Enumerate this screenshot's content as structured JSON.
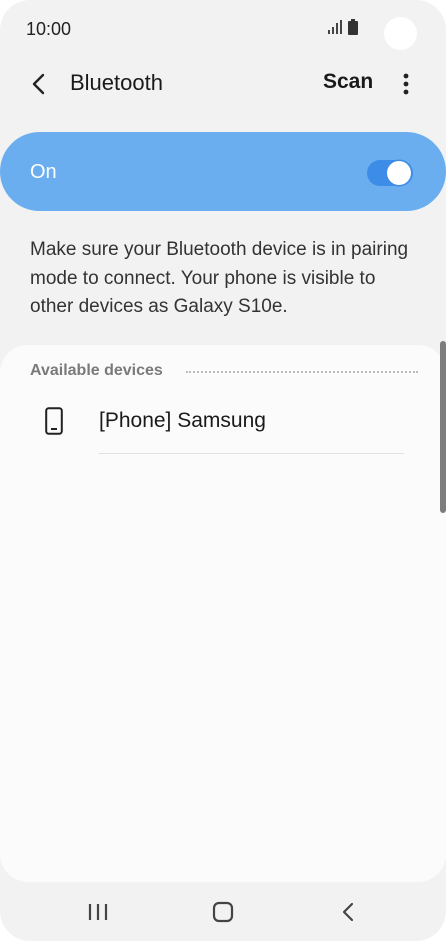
{
  "status_bar": {
    "time": "10:00",
    "icons": [
      "signal-icon",
      "battery-icon"
    ]
  },
  "app_bar": {
    "title": "Bluetooth",
    "scan_label": "Scan",
    "back_icon": "back-arrow-icon",
    "more_icon": "more-options-icon"
  },
  "master_switch": {
    "label": "On",
    "enabled": true
  },
  "description": "Make sure your Bluetooth device is in pairing mode to connect. Your phone is visible to other devices as Galaxy S10e.",
  "available_devices": {
    "header": "Available devices",
    "items": [
      {
        "name": "[Phone] Samsung",
        "icon": "phone-icon"
      }
    ]
  },
  "nav_bar": {
    "buttons": [
      "recent-apps-icon",
      "home-icon",
      "back-icon"
    ]
  },
  "colors": {
    "accent": "#3c8ce8",
    "master_card": "#6aaef0",
    "background": "#f2f2f2"
  }
}
